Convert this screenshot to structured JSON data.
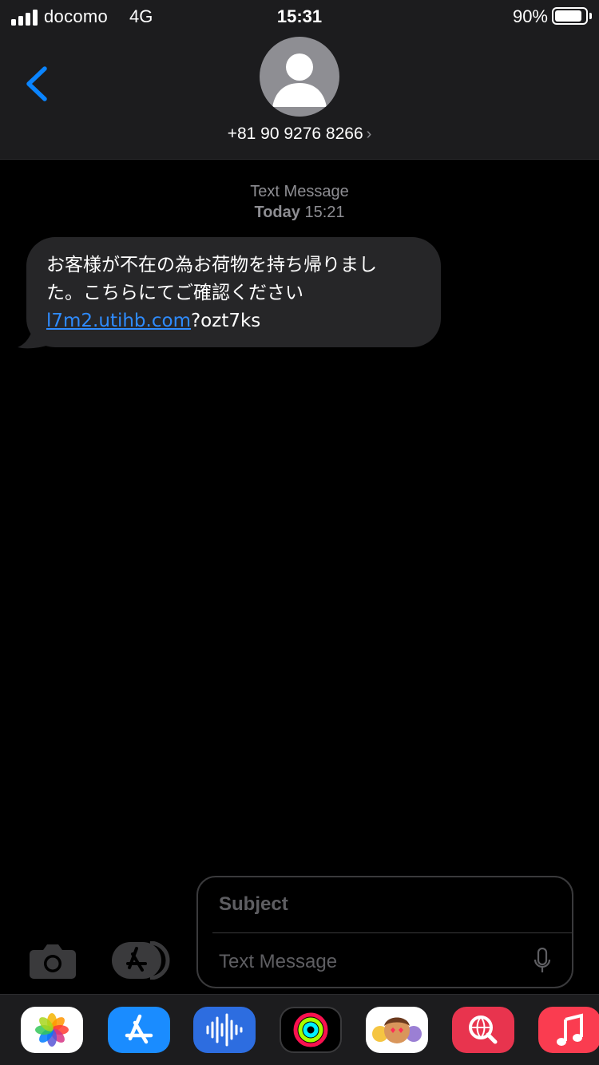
{
  "status_bar": {
    "carrier": "docomo",
    "network": "4G",
    "time": "15:31",
    "battery_percent": "90%",
    "battery_level": 0.9
  },
  "header": {
    "back_icon": "chevron-left-icon",
    "avatar_icon": "person-silhouette-icon",
    "contact_number": "+81 90 9276 8266",
    "contact_chevron": "›"
  },
  "conversation": {
    "service_label": "Text Message",
    "timestamp_day": "Today",
    "timestamp_time": "15:21",
    "message": {
      "line1": "お客様が不在の為お荷物を持ち帰りまし",
      "line2": "た。こちらにてご確認ください",
      "link_text": "l7m2.utihb.com",
      "trailing_text": "?ozt7ks"
    }
  },
  "composer": {
    "subject_placeholder": "Subject",
    "message_placeholder": "Text Message",
    "camera_icon": "camera-icon",
    "apps_icon": "app-store-icon",
    "mic_icon": "microphone-icon"
  },
  "dock_apps": [
    "photos",
    "app-store",
    "voice-memos",
    "activity",
    "memoji",
    "search-web",
    "music"
  ],
  "colors": {
    "background": "#000000",
    "header_background": "#1c1c1e",
    "bubble": "#262628",
    "link": "#2f8cff",
    "accent_blue": "#0a84ff",
    "placeholder": "#5e5e62",
    "secondary_text": "#8e8e93"
  }
}
